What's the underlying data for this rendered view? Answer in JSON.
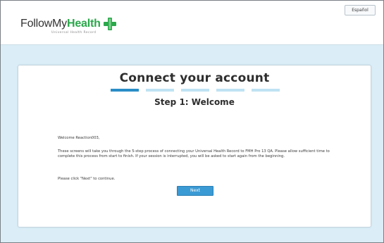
{
  "header": {
    "lang_button": "Español",
    "logo": {
      "follow": "FollowMy",
      "health": "Health",
      "tagline": "Universal Health Record",
      "trademark": "®"
    }
  },
  "card": {
    "title": "Connect your account",
    "progress": {
      "total_steps": 5,
      "current_step": 1
    },
    "step_title": "Step 1: Welcome",
    "welcome": "Welcome Reaction003,",
    "paragraph": "These screens will take you through the 5-step process of connecting your Universal Health Record to FMH Pro 13 QA. Please allow sufficient time to complete this process from start to finish. If your session is interrupted, you will be asked to start again from the beginning.",
    "instruction": "Please click \"Next\" to continue.",
    "next_label": "Next"
  },
  "colors": {
    "brand_green": "#2aa84a",
    "accent_blue": "#3a9ad4",
    "progress_active": "#2a8ec7",
    "progress_inactive": "#bfe2f3",
    "page_bg": "#dbeef8"
  }
}
